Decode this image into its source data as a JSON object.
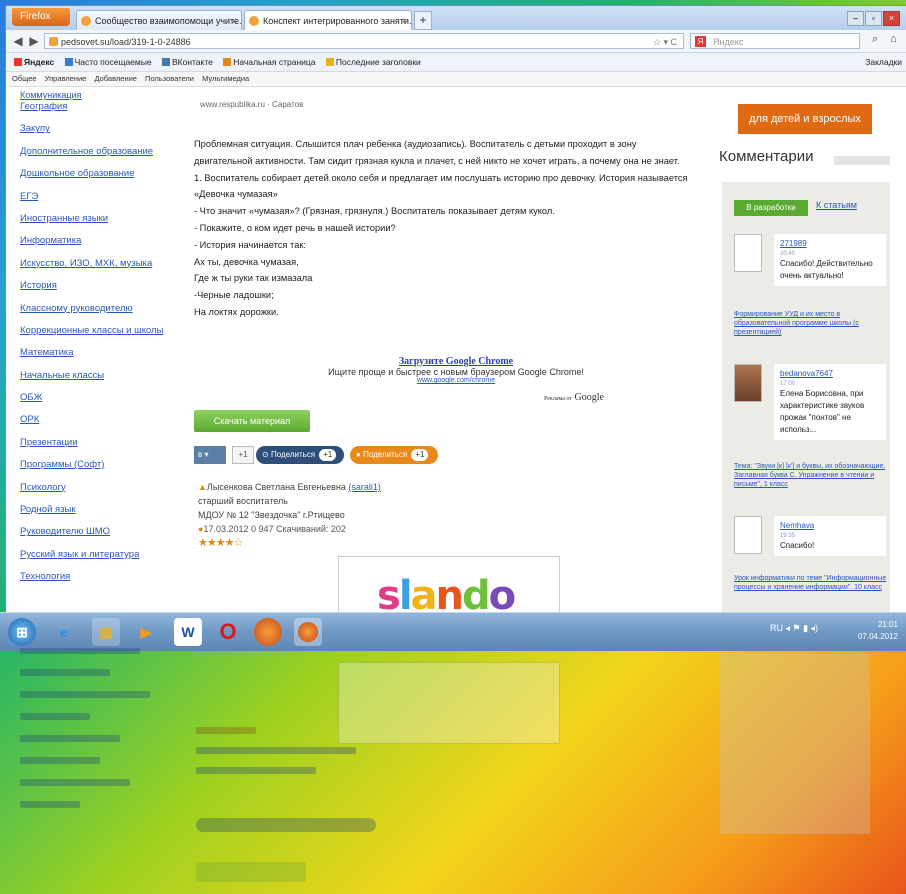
{
  "browser": {
    "menu_button": "Firefox",
    "tabs": [
      {
        "title": "Сообщество взаимопомощи учите..."
      },
      {
        "title": "Конспект интегрированного заняти..."
      }
    ],
    "new_tab": "+",
    "url": "pedsovet.su/load/319-1-0-24886",
    "search_placeholder": "Яндекс",
    "bookmarks": [
      "Яндекс",
      "Часто посещаемые",
      "ВКонтакте",
      "Начальная страница",
      "Последние заголовки"
    ],
    "bookmarks_right": "Закладки",
    "menubar": [
      "Общее",
      "Управление",
      "Добавление",
      "Пользователи",
      "Мультимедиа"
    ]
  },
  "sidebar": {
    "top_partial": "Коммуникация",
    "items": [
      "География",
      "Закупу",
      "Дополнительное образование",
      "Дошкольное образование",
      "ЕГЭ",
      "Иностранные языки",
      "Информатика",
      "Искусство, ИЗО, МХК, музыка",
      "История",
      "Классному руководителю",
      "Коррекционные классы и школы",
      "Математика",
      "Начальные классы",
      "ОБЖ",
      "ОРК",
      "Презентации",
      "Программы (Софт)",
      "Психологу",
      "Родной язык",
      "Руководителю ШМО",
      "Русский язык и литература",
      "Технология"
    ]
  },
  "content": {
    "source": "www.respublika.ru · Саратов",
    "paragraph_lines": [
      "Проблемная ситуация. Слышится плач ребенка (аудиозапись). Воспитатель с детьми проходит в зону",
      "двигательной активности. Там сидит грязная кукла и плачет, с ней никто не хочет играть, а почему она не знает.",
      "1. Воспитатель собирает детей около себя и предлагает им послушать историю про девочку. История называется",
      "«Девочка чумазая»",
      "- Что значит «чумазая»? (Грязная, грязнуля.) Воспитатель показывает детям кукол.",
      "- Покажите, о ком идет речь в нашей истории?",
      "- История начинается так:",
      "Ах ты, девочка чумазая,",
      "Где ж ты руки так измазала",
      "-Черные ладошки;",
      "На локтях дорожки."
    ],
    "chrome_ad": {
      "title": "Загрузите Google Chrome",
      "subtitle": "Ищите проще и быстрее с новым браузером Google Chrome!",
      "url": "www.google.com/chrome",
      "by": "Реклама от",
      "brand": "Google"
    },
    "download_button": "Скачать материал",
    "share": {
      "vk_count": "+1",
      "social1": "Поделиться",
      "social1_count": "+1",
      "social2": "Поделиться",
      "social2_count": "+1"
    },
    "author": {
      "name": "Лысенкова Светлана Евгеньевна",
      "link": "(sarali1)",
      "role": "старший воспитатель",
      "org": "МДОУ № 12 \"Звездочка\" г.Ртищево",
      "meta": "17.03.2012  0  947  Скачиваний: 202",
      "rating_stars": "★★★★☆"
    },
    "banner_logo": "slando"
  },
  "right": {
    "promo": "для детей и взрослых",
    "comments_title": "Комментарии",
    "tab_active": "В разработки",
    "tab_inactive": "К статьям",
    "comments": [
      {
        "user": "271989",
        "time": "20:40",
        "text": "Спасибо! Действительно очень актуально!"
      },
      {
        "user": "bedanova7647",
        "time": "17:00",
        "text": "Елена Борисовна, при характеристике звуков прожак \"понтов\" не использ..."
      },
      {
        "user": "Nemhava",
        "time": "19:35",
        "text": "Спасибо!"
      }
    ],
    "comment_links": [
      "Формирование УУД и их место в образовательной программе школы (с презентацией)",
      "Тема: \"Звуки [к] [к'] и буквы, их обозначающие. Заглавная буква С. Упражнение в чтении и письме\", 1 класс",
      "Урок информатики по теме \"Информационные процессы и хранение информации\". 10 класс"
    ]
  },
  "taskbar": {
    "apps": [
      "start",
      "ie",
      "explorer",
      "media",
      "word",
      "opera",
      "firefox",
      "firefox2"
    ],
    "tray_icons": "RU  ◂  ⚑  ▮  ◂)",
    "time": "21:01",
    "date": "07.04.2012"
  },
  "colors": {
    "link": "#2a58b8",
    "download_green": "#5aa930",
    "promo_orange": "#e06a14",
    "taskbar": "#6f98c4"
  }
}
